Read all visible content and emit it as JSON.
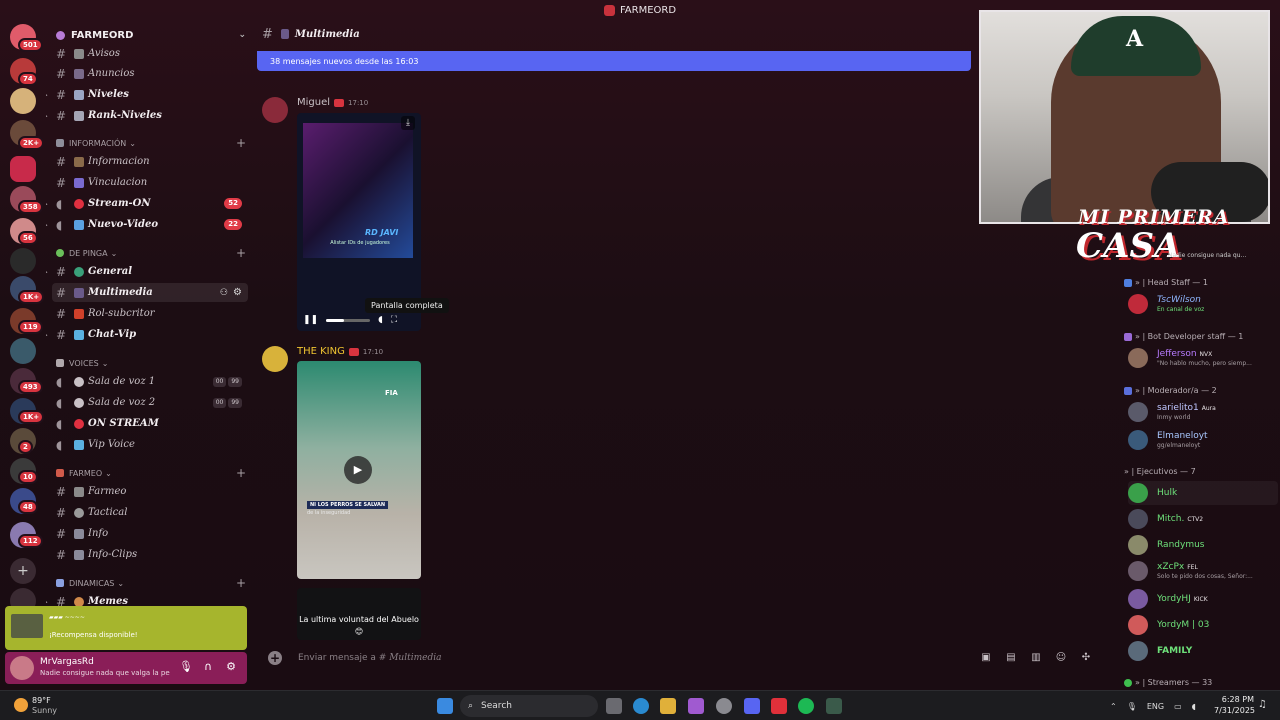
{
  "window": {
    "title": "FARMEORD"
  },
  "server_rail": {
    "badges": [
      "501",
      "74",
      "2K+",
      "358",
      "56",
      "1K+",
      "119",
      "493",
      "1K+",
      "2",
      "10",
      "48",
      "112"
    ]
  },
  "sidebar": {
    "server_name": "FARMEORD",
    "channels_top": [
      {
        "label": "Avisos",
        "bold": false
      },
      {
        "label": "Anuncios",
        "bold": false
      },
      {
        "label": "Niveles",
        "bold": true
      },
      {
        "label": "Rank-Niveles",
        "bold": true
      }
    ],
    "category_informacion": "INFORMACIÓN",
    "channels_info": [
      {
        "label": "Informacion",
        "bold": false
      },
      {
        "label": "Vinculacion",
        "bold": false
      },
      {
        "label": "Stream-ON",
        "bold": true,
        "count": "52"
      },
      {
        "label": "Nuevo-Video",
        "bold": true,
        "count": "22"
      }
    ],
    "category_depinga": "DE PINGA",
    "channels_depinga": [
      {
        "label": "General",
        "bold": true
      },
      {
        "label": "Multimedia",
        "bold": true
      },
      {
        "label": "Rol-subcritor",
        "bold": false
      },
      {
        "label": "Chat-Vip",
        "bold": true
      }
    ],
    "category_voices": "VOICES",
    "voice_channels": [
      {
        "label": "Sala de voz 1",
        "a": "00",
        "b": "99"
      },
      {
        "label": "Sala de voz 2",
        "a": "00",
        "b": "99"
      },
      {
        "label": "ON STREAM"
      },
      {
        "label": "Vip Voice"
      }
    ],
    "category_farmeo": "FARMEO",
    "channels_farmeo": [
      {
        "label": "Farmeo"
      },
      {
        "label": "Tactical"
      },
      {
        "label": "Info"
      },
      {
        "label": "Info-Clips"
      }
    ],
    "category_dinamicas": "DINAMICAS",
    "channels_dinamicas": [
      {
        "label": "Memes"
      }
    ],
    "reward": {
      "text": "¡Recompensa disponible!"
    },
    "user": {
      "name": "MrVargasRd",
      "status": "Nadie consigue nada que valga la pena ..."
    }
  },
  "main": {
    "channel_name": "Multimedia",
    "new_messages_bar": "38 mensajes nuevos desde las 16:03",
    "messages": [
      {
        "author": "Miguel",
        "author_color": "#c9c1c6",
        "time": "17:10",
        "video_caption": "Alistar IDs de jugadores",
        "video_label": "RD JAVI",
        "progress": 0.4,
        "tooltip": "Pantalla completa"
      },
      {
        "author": "THE KING",
        "author_color": "#f0c531",
        "time": "17:10",
        "video_caption_1": "NI LOS PERROS SE SALVAN",
        "video_caption_2": "de la inseguridad",
        "video_brand": "FIA"
      }
    ],
    "third_video_text": "La ultima voluntad del Abuelo 😊",
    "composer_placeholder_prefix": "Enviar mensaje a #",
    "composer_placeholder_channel": "Multimedia"
  },
  "overlay": {
    "title_line1": "MI PRIMERA",
    "title_line2": "CASA",
    "subtitle": "Nadie consigue nada qu..."
  },
  "members": {
    "categories": [
      {
        "label": "» | Head Staff — 1",
        "color": "#4f7fe0"
      },
      {
        "label": "» | Bot Developer staff — 1",
        "color": "#9a6ad6"
      },
      {
        "label": "» | Moderador/a — 2",
        "color": "#5a6fdc"
      },
      {
        "label": "» | Ejecutivos — 7",
        "color": "#6a6a6a"
      },
      {
        "label": "» | Streamers — 33",
        "color": "#3fbf4f"
      }
    ],
    "list": [
      {
        "name": "TscWilson",
        "sub": "En canal de voz",
        "color": "#8fb6ff",
        "tag": ""
      },
      {
        "name": "Jefferson",
        "sub": "\"No hablo mucho, pero siemp...",
        "color": "#b77bff",
        "tag": "NVX"
      },
      {
        "name": "sarielito1",
        "sub": "Inmy world",
        "color": "#bfc6ff",
        "tag": "Aura"
      },
      {
        "name": "Elmaneloyt",
        "sub": "gg/elmaneloyt",
        "color": "#a9c8ff",
        "tag": ""
      },
      {
        "name": "Hulk",
        "sub": "",
        "color": "#6ee07a",
        "tag": ""
      },
      {
        "name": "Mitch.",
        "sub": "",
        "color": "#6ee07a",
        "tag": "CTV2"
      },
      {
        "name": "Randymus",
        "sub": "",
        "color": "#6ee07a",
        "tag": ""
      },
      {
        "name": "xZcPx",
        "sub": "Solo te pido dos cosas, Señor:...",
        "color": "#6ee07a",
        "tag": "FEL"
      },
      {
        "name": "YordyHJ",
        "sub": "",
        "color": "#6ee07a",
        "tag": "KICK"
      },
      {
        "name": "YordyM | 03",
        "sub": "",
        "color": "#6ee07a",
        "tag": ""
      },
      {
        "name": "FAMILY",
        "sub": "",
        "color": "#6ee07a",
        "tag": ""
      }
    ]
  },
  "taskbar": {
    "weather_temp": "89°F",
    "weather_desc": "Sunny",
    "search_label": "Search",
    "lang": "ENG",
    "time": "6:28 PM",
    "date": "7/31/2025"
  }
}
